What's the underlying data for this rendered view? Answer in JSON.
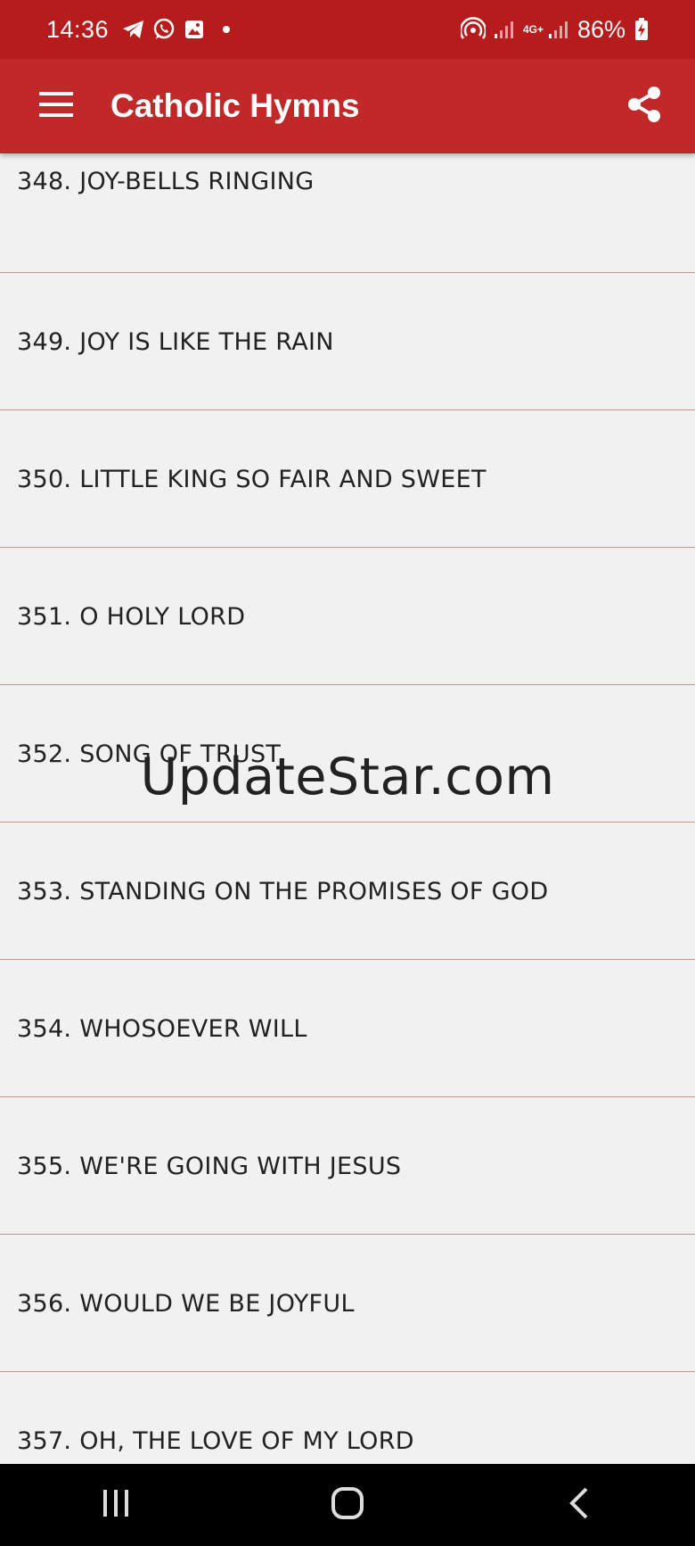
{
  "status_bar": {
    "time": "14:36",
    "network_label": "4G+",
    "battery_percent": "86%",
    "left_icons": [
      "telegram-icon",
      "whatsapp-icon",
      "gallery-icon",
      "notification-dot"
    ],
    "right_icons": [
      "hotspot-icon",
      "signal-icon",
      "data-arrows-icon",
      "signal-icon",
      "battery-charging-icon"
    ]
  },
  "app_bar": {
    "title": "Catholic Hymns",
    "menu_icon": "hamburger-menu-icon",
    "share_icon": "share-icon"
  },
  "hymns": [
    {
      "label": "348. JOY-BELLS RINGING"
    },
    {
      "label": "349. JOY IS LIKE THE RAIN"
    },
    {
      "label": "350. LITTLE KING SO FAIR AND SWEET"
    },
    {
      "label": "351. O HOLY LORD"
    },
    {
      "label": "352. SONG OF TRUST"
    },
    {
      "label": "353. STANDING ON THE PROMISES OF GOD"
    },
    {
      "label": "354. WHOSOEVER WILL"
    },
    {
      "label": "355. WE'RE GOING WITH JESUS"
    },
    {
      "label": "356. WOULD WE BE JOYFUL"
    },
    {
      "label": "357. OH, THE LOVE OF MY LORD"
    }
  ],
  "watermark": "UpdateStar.com",
  "nav_bar": {
    "buttons": [
      "recents-icon",
      "home-icon",
      "back-icon"
    ]
  },
  "colors": {
    "status_bar": "#b71c1c",
    "app_bar": "#c0282a",
    "list_background": "#f1f1f1",
    "divider": "#c79494"
  }
}
